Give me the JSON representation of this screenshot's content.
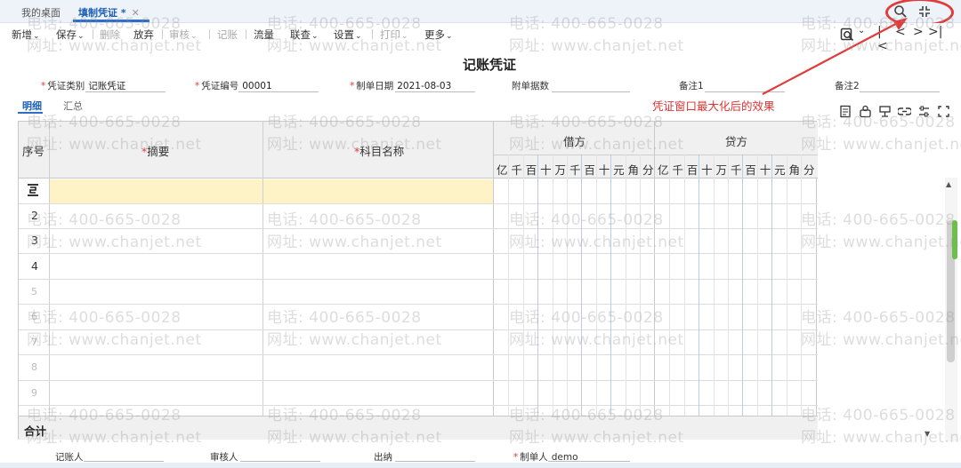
{
  "tabs": [
    {
      "label": "我的桌面"
    },
    {
      "label": "填制凭证 *"
    }
  ],
  "toolbar": {
    "buttons": [
      {
        "label": "新增"
      },
      {
        "label": "保存"
      },
      {
        "label": "删除"
      },
      {
        "label": "放弃"
      },
      {
        "label": "审核"
      },
      {
        "label": "记账"
      },
      {
        "label": "流量"
      },
      {
        "label": "联查"
      },
      {
        "label": "设置"
      },
      {
        "label": "打印"
      },
      {
        "label": "更多"
      }
    ]
  },
  "document": {
    "title": "记账凭证",
    "fields": {
      "voucher_type_label": "凭证类别",
      "voucher_type_value": "记账凭证",
      "voucher_no_label": "凭证编号",
      "voucher_no_value": "00001",
      "date_label": "制单日期",
      "date_value": "2021-08-03",
      "attachments_label": "附单据数",
      "note1_label": "备注1",
      "note2_label": "备注2"
    },
    "subtabs": [
      "明细",
      "汇总"
    ]
  },
  "annotation": "凭证窗口最大化后的效果",
  "grid": {
    "headers": {
      "seq": "序号",
      "summary": "摘要",
      "account": "科目名称",
      "debit": "借方",
      "credit": "贷方"
    },
    "digits": [
      "亿",
      "千",
      "百",
      "十",
      "万",
      "千",
      "百",
      "十",
      "元",
      "角",
      "分"
    ],
    "rows": [
      "",
      "2",
      "3",
      "4",
      "5",
      "6",
      "7",
      "8",
      "9"
    ],
    "total_label": "合计"
  },
  "footer": {
    "bookkeeper_label": "记账人",
    "reviewer_label": "审核人",
    "cashier_label": "出纳",
    "maker_label": "制单人",
    "maker_value": "demo"
  },
  "watermark": {
    "phone": "电话: 400-665-0028",
    "site": "网址: www.chanjet.net"
  },
  "colors": {
    "accent": "#2f6ec6",
    "annotation_red": "#e23b3b",
    "active_row": "#fdf3c7",
    "scroll_grip": "#6cbf4a"
  }
}
